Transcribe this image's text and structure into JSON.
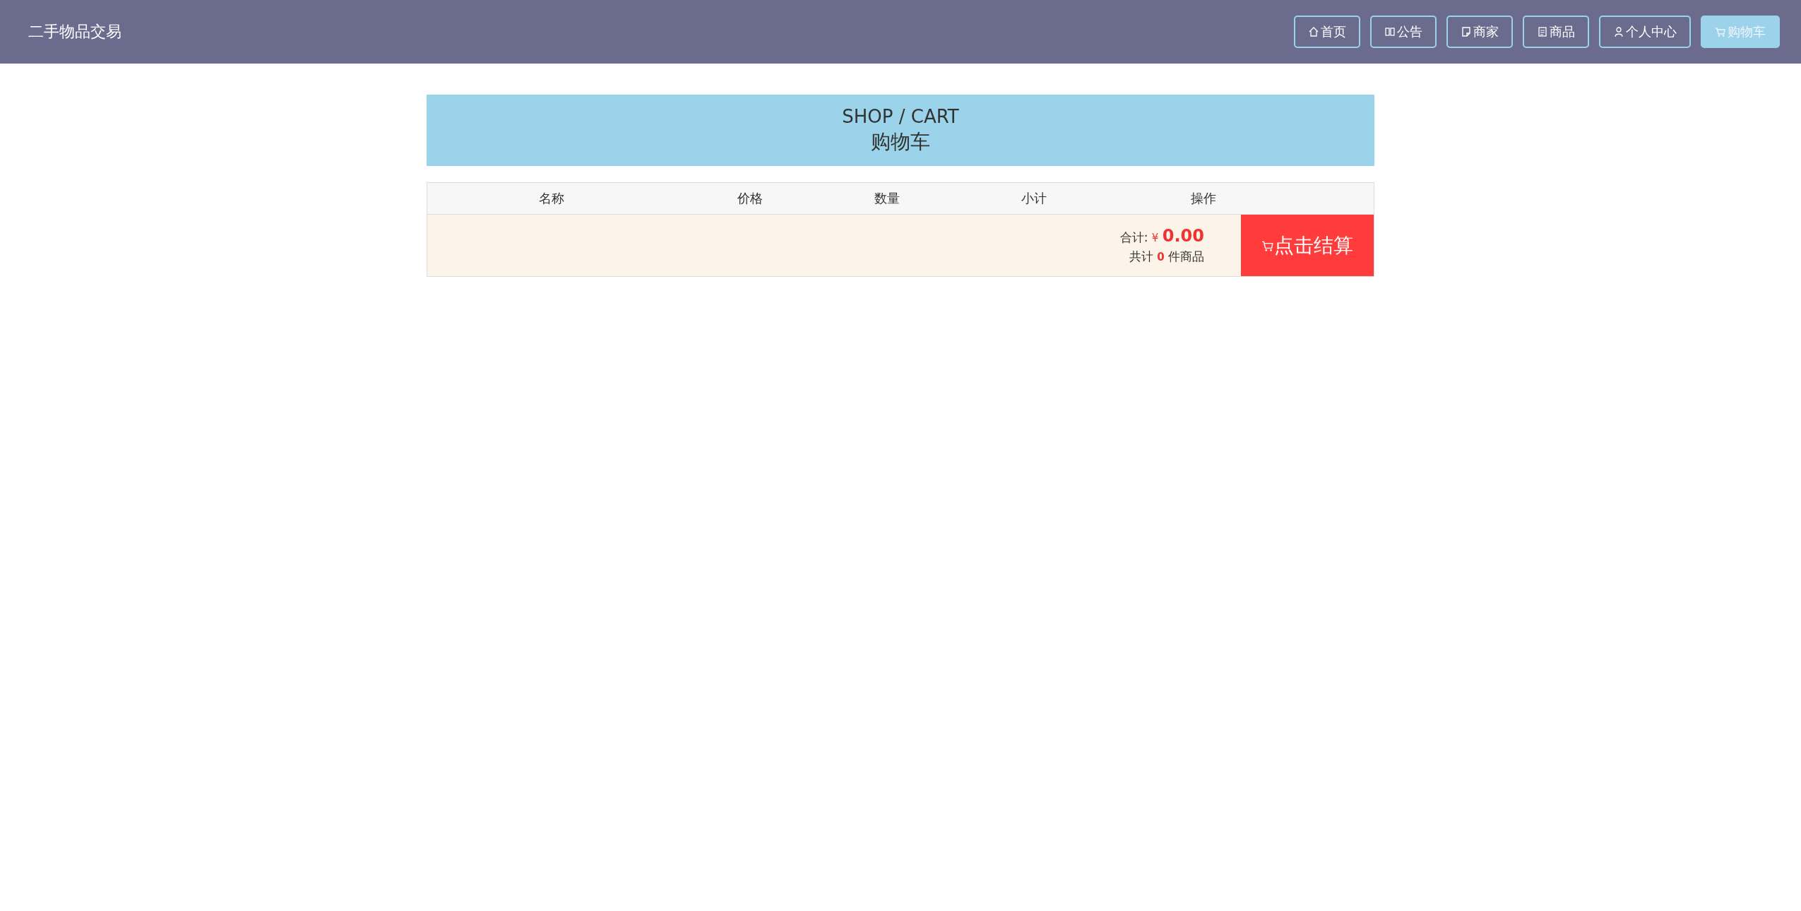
{
  "navbar": {
    "brand": "二手物品交易",
    "items": [
      {
        "label": "首页",
        "selected": false
      },
      {
        "label": "公告",
        "selected": false
      },
      {
        "label": "商家",
        "selected": false
      },
      {
        "label": "商品",
        "selected": false
      },
      {
        "label": "个人中心",
        "selected": false
      },
      {
        "label": "购物车",
        "selected": true
      }
    ]
  },
  "banner": {
    "title": "SHOP / CART",
    "subtitle": "购物车"
  },
  "cart_table": {
    "columns": [
      "名称",
      "价格",
      "数量",
      "小计",
      "操作"
    ],
    "summary": {
      "total_label": "合计:",
      "currency": "¥",
      "total": "0.00",
      "count_prefix": "共计",
      "count": "0",
      "count_suffix": "件商品"
    },
    "checkout_button": "点击结算"
  }
}
